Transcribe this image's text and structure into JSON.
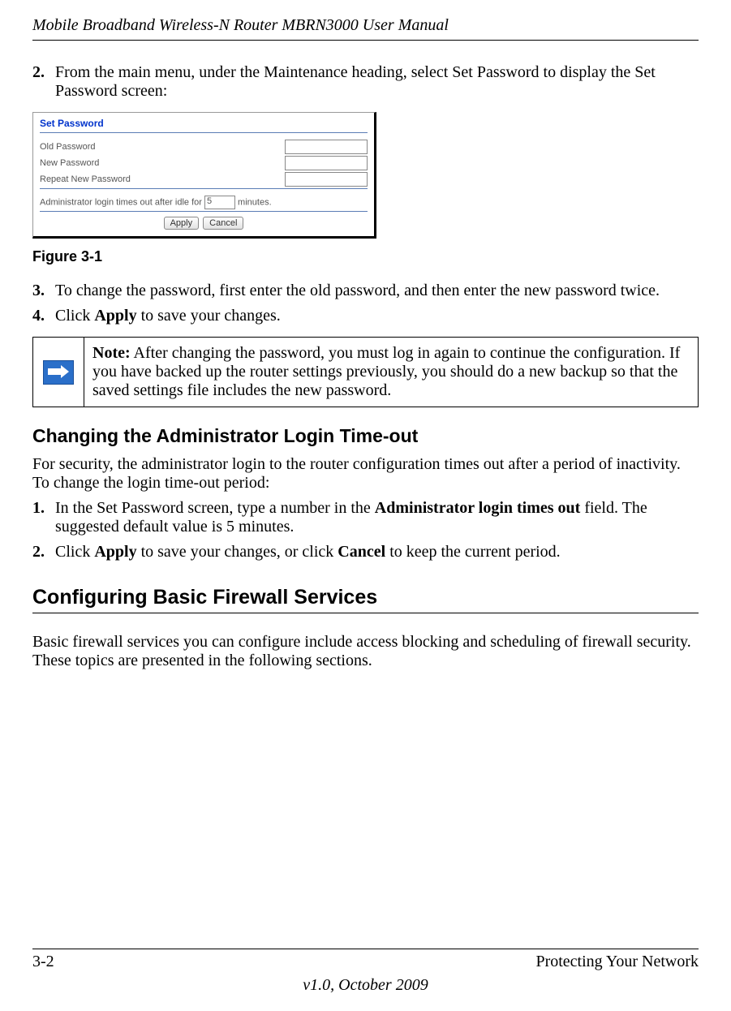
{
  "header": {
    "title": "Mobile Broadband Wireless-N Router MBRN3000 User Manual"
  },
  "steps_a": [
    {
      "num": "2.",
      "text_a": "From the main menu, under the Maintenance heading, select Set Password to display the Set Password screen:"
    },
    {
      "num": "3.",
      "text_a": "To change the password, first enter the old password, and then enter the new password twice."
    },
    {
      "num": "4.",
      "text_a": "Click ",
      "bold": "Apply",
      "text_b": " to save your changes."
    }
  ],
  "screenshot": {
    "title": "Set Password",
    "old": "Old Password",
    "new": "New Password",
    "repeat": "Repeat New Password",
    "timeout_a": "Administrator login times out after idle for",
    "timeout_val": "5",
    "timeout_b": "minutes.",
    "apply": "Apply",
    "cancel": "Cancel"
  },
  "figure": {
    "label": "Figure 3-1"
  },
  "note": {
    "prefix": "Note:",
    "text": " After changing the password, you must log in again to continue the configuration. If you have backed up the router settings previously, you should do a new backup so that the saved settings file includes the new password."
  },
  "subheading": "Changing the Administrator Login Time-out",
  "sub_para": "For security, the administrator login to the router configuration times out after a period of inactivity. To change the login time-out period:",
  "steps_b": [
    {
      "num": "1.",
      "text_a": "In the Set Password screen, type a number in the ",
      "bold": "Administrator login times out",
      "text_b": " field. The suggested default value is 5 minutes."
    },
    {
      "num": "2.",
      "text_a": "Click ",
      "bold": "Apply",
      "text_b": " to save your changes, or click ",
      "bold2": "Cancel",
      "text_c": " to keep the current period."
    }
  ],
  "section": "Configuring Basic Firewall Services",
  "section_para": "Basic firewall services you can configure include access blocking and scheduling of firewall security. These topics are presented in the following sections.",
  "footer": {
    "page": "3-2",
    "topic": "Protecting Your Network",
    "version": "v1.0, October 2009"
  }
}
